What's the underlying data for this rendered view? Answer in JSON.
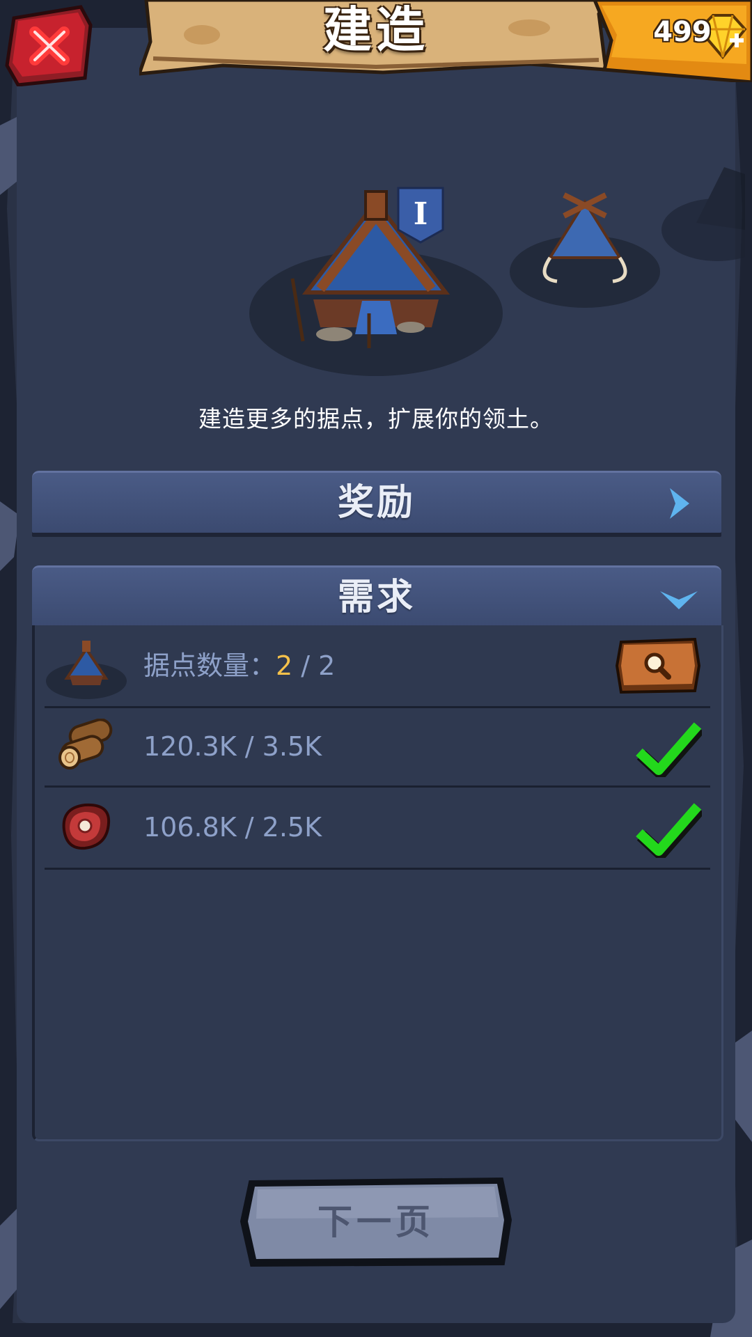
{
  "header": {
    "title": "建造",
    "close_icon": "close-x-icon",
    "gems": {
      "value": "499",
      "icon": "gem-plus-icon"
    }
  },
  "preview": {
    "selected_level_badge": "I",
    "items": [
      "camp-hut-level1",
      "camp-hut-level2",
      "camp-hut-level3"
    ]
  },
  "description": "建造更多的据点，扩展你的领土。",
  "sections": {
    "rewards": {
      "label": "奖励",
      "icon": "chevron-right-icon"
    },
    "requirements": {
      "label": "需求",
      "icon": "chevron-down-icon",
      "items": [
        {
          "icon": "outpost-icon",
          "label": "据点数量：",
          "current": "2",
          "separator": " / ",
          "required": "2",
          "action_icon": "magnifier-icon"
        },
        {
          "icon": "wood-log-icon",
          "text": "120.3K / 3.5K",
          "status_icon": "check-icon"
        },
        {
          "icon": "meat-icon",
          "text": "106.8K / 2.5K",
          "status_icon": "check-icon"
        }
      ]
    }
  },
  "footer": {
    "next_label": "下一页"
  },
  "colors": {
    "panel": "#303a52",
    "header": "#3b4a70",
    "accent_gold": "#f5c14a",
    "check_green": "#23d81c",
    "close_red": "#c7222e"
  }
}
